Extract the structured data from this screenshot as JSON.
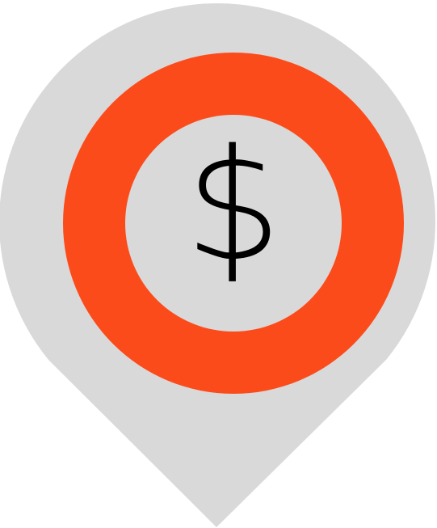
{
  "icon": {
    "name": "map-pin-dollar-icon",
    "symbol": "$",
    "colors": {
      "pin": "#d9d9d9",
      "ring": "#fc4b1a",
      "inner": "#d9d9d9",
      "glyph": "#000000"
    }
  }
}
